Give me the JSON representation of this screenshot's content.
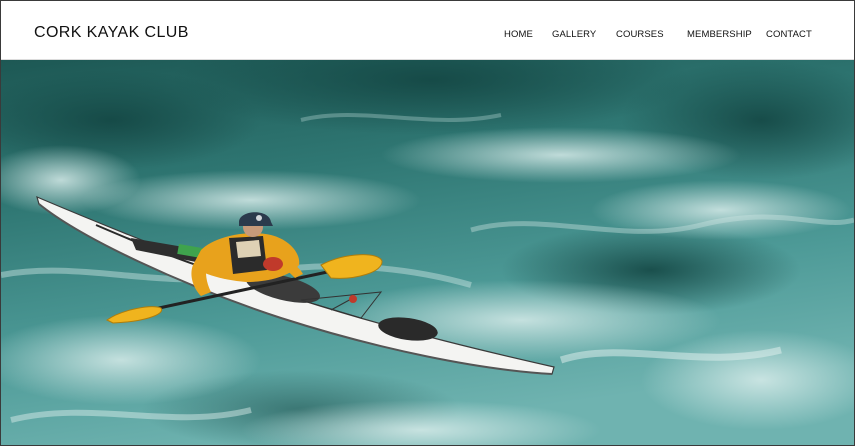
{
  "header": {
    "logo": "CORK KAYAK CLUB",
    "nav": [
      {
        "label": "HOME"
      },
      {
        "label": "GALLERY"
      },
      {
        "label": "COURSES"
      },
      {
        "label": "MEMBERSHIP"
      },
      {
        "label": "CONTACT"
      }
    ]
  },
  "hero": {
    "subject": "sea kayaker paddling in rough turquoise water",
    "colors": {
      "water_dark": "#1f5f5a",
      "water_mid": "#3f8c89",
      "water_light": "#8fc8c4",
      "foam": "#e8f3f1",
      "jacket": "#e8a21c",
      "paddle_blade": "#f0b41e",
      "kayak_deck": "#f4f4f2",
      "helmet": "#2b3a4c"
    }
  }
}
